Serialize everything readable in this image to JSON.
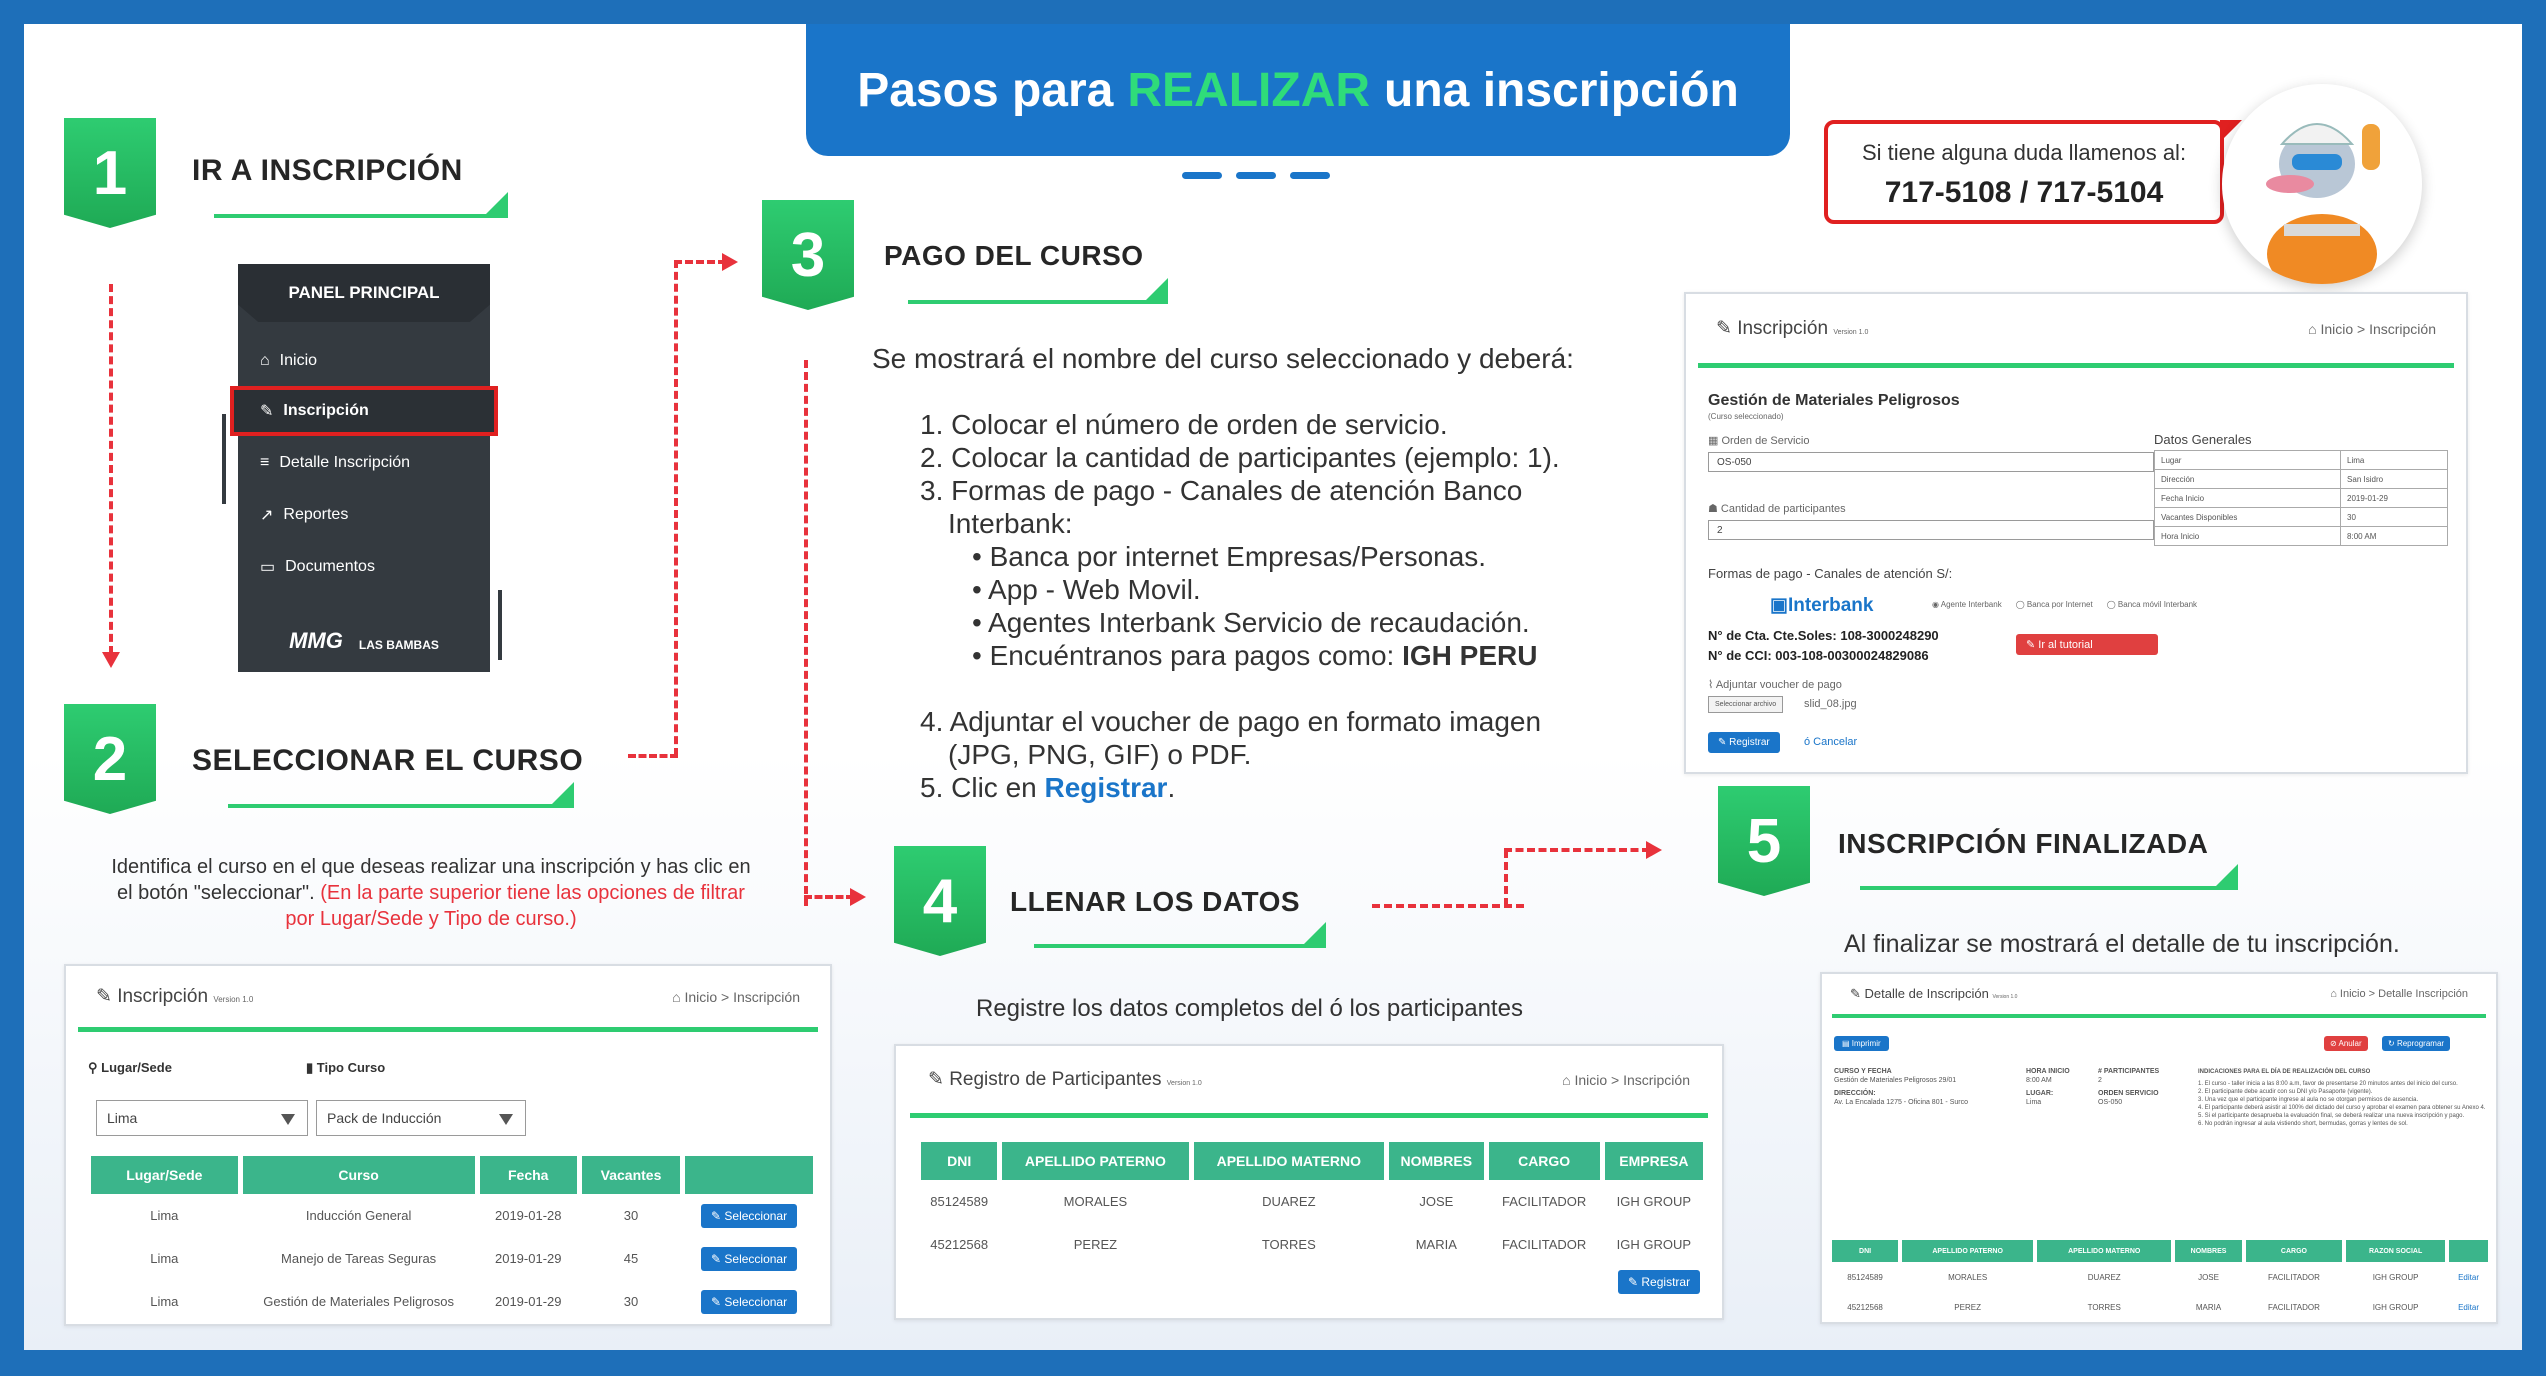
{
  "header": {
    "title_pre": "Pasos para",
    "title_hl": "REALIZAR",
    "title_post": "una inscripción"
  },
  "help": {
    "question": "Si tiene alguna duda llamenos al:",
    "phones": "717-5108 / 717-5104"
  },
  "steps": [
    {
      "num": "1",
      "title": "IR A INSCRIPCIÓN"
    },
    {
      "num": "2",
      "title": "SELECCIONAR EL CURSO"
    },
    {
      "num": "3",
      "title": "PAGO DEL CURSO"
    },
    {
      "num": "4",
      "title": "LLENAR LOS DATOS"
    },
    {
      "num": "5",
      "title": "INSCRIPCIÓN FINALIZADA"
    }
  ],
  "panel": {
    "header": "PANEL PRINCIPAL",
    "items": [
      "Inicio",
      "Inscripción",
      "Detalle Inscripción",
      "Reportes",
      "Documentos"
    ],
    "logo1": "MMG",
    "logo2": "LAS BAMBAS"
  },
  "step2": {
    "text": "Identifica el curso en el que deseas realizar una inscripción  y has clic en el botón \"seleccionar\".",
    "note": "(En la parte superior tiene las opciones de filtrar por Lugar/Sede y Tipo de curso.)"
  },
  "shot2": {
    "title": "Inscripción",
    "version": "Version 1.0",
    "breadcrumb": "Inicio > Inscripción",
    "filter1_label": "Lugar/Sede",
    "filter2_label": "Tipo Curso",
    "filter1_value": "Lima",
    "filter2_value": "Pack de Inducción",
    "columns": [
      "Lugar/Sede",
      "Curso",
      "Fecha",
      "Vacantes",
      ""
    ],
    "rows": [
      {
        "lugar": "Lima",
        "curso": "Inducción General",
        "fecha": "2019-01-28",
        "vacantes": "30",
        "btn": "Seleccionar"
      },
      {
        "lugar": "Lima",
        "curso": "Manejo de Tareas Seguras",
        "fecha": "2019-01-29",
        "vacantes": "45",
        "btn": "Seleccionar"
      },
      {
        "lugar": "Lima",
        "curso": "Gestión de Materiales Peligrosos",
        "fecha": "2019-01-29",
        "vacantes": "30",
        "btn": "Seleccionar"
      }
    ]
  },
  "step3": {
    "intro": "Se mostrará el nombre del curso seleccionado y deberá:",
    "l1": "1. Colocar el número de orden de servicio.",
    "l2": "2. Colocar la cantidad de participantes (ejemplo: 1).",
    "l3a": "3. Formas de pago - Canales de atención Banco",
    "l3b": "Interbank:",
    "b1": "Banca por internet Empresas/Personas.",
    "b2": "App - Web Movil.",
    "b3": "Agentes Interbank Servicio de recaudación.",
    "b4pre": "Encuéntranos para pagos como: ",
    "b4strong": "IGH PERU",
    "l4a": "4. Adjuntar el voucher de pago en formato imagen",
    "l4b": "(JPG, PNG, GIF) o PDF.",
    "l5pre": "5. Clic en ",
    "l5link": "Registrar",
    "l5post": "."
  },
  "shot3": {
    "title": "Inscripción",
    "version": "Version 1.0",
    "breadcrumb": "Inicio > Inscripción",
    "course": "Gestión de Materiales Peligrosos",
    "course_sub": "(Curso seleccionado)",
    "orden_label": "Orden de Servicio",
    "orden_value": "OS-050",
    "cant_label": "Cantidad de participantes",
    "cant_value": "2",
    "datos_label": "Datos Generales",
    "datos": [
      {
        "k": "Lugar",
        "v": "Lima"
      },
      {
        "k": "Dirección",
        "v": "San Isidro"
      },
      {
        "k": "Fecha Inicio",
        "v": "2019-01-29"
      },
      {
        "k": "Vacantes Disponibles",
        "v": "30"
      },
      {
        "k": "Hora Inicio",
        "v": "8:00 AM"
      }
    ],
    "pago_label": "Formas de pago - Canales de atención S/:",
    "bank": "Interbank",
    "radios": [
      "Agente Interbank",
      "Banca por Internet",
      "Banca móvil Interbank"
    ],
    "cta": "N° de Cta. Cte.Soles: 108-3000248290",
    "cci": "N° de CCI: 003-108-00300024829086",
    "tutorial": "Ir al tutorial",
    "voucher_label": "Adjuntar voucher de pago",
    "file_btn": "Seleccionar archivo",
    "file_name": "slid_08.jpg",
    "register": "Registrar",
    "cancel": "ó Cancelar"
  },
  "step4": {
    "text": "Registre los datos completos del ó los participantes"
  },
  "shot4": {
    "title": "Registro de Participantes",
    "version": "Version 1.0",
    "breadcrumb": "Inicio > Inscripción",
    "columns": [
      "DNI",
      "APELLIDO PATERNO",
      "APELLIDO MATERNO",
      "NOMBRES",
      "CARGO",
      "EMPRESA"
    ],
    "rows": [
      [
        "85124589",
        "MORALES",
        "DUAREZ",
        "JOSE",
        "FACILITADOR",
        "IGH GROUP"
      ],
      [
        "45212568",
        "PEREZ",
        "TORRES",
        "MARIA",
        "FACILITADOR",
        "IGH GROUP"
      ]
    ],
    "register": "Registrar"
  },
  "step5": {
    "text": "Al finalizar se mostrará el detalle de tu inscripción."
  },
  "shot5": {
    "title": "Detalle de Inscripción",
    "version": "Version 1.0",
    "breadcrumb": "Inicio > Detalle Inscripción",
    "print": "Imprimir",
    "cancel": "Anular",
    "reprog": "Reprogramar",
    "curso_label": "CURSO Y FECHA",
    "curso_value": "Gestión de Materiales Peligrosos 29/01",
    "dir_label": "DIRECCIÓN:",
    "dir_value": "Av. La Encalada 1275 - Oficina 801 - Surco",
    "hora_label": "HORA INICIO",
    "hora_value": "8:00 AM",
    "lugar_label": "LUGAR:",
    "lugar_value": "Lima",
    "part_label": "# PARTICIPANTES",
    "part_value": "2",
    "orden_label": "ORDEN SERVICIO",
    "orden_value": "OS-050",
    "ind_title": "INDICACIONES PARA EL DÍA DE REALIZACIÓN DEL CURSO",
    "ind": [
      "1. El curso - taller inicia a las 8:00 a.m, favor de presentarse 20 minutos antes del inicio del curso.",
      "2. El participante debe acudir con su DNI y/o Pasaporte (vigente).",
      "3. Una vez que el participante ingrese al aula no se otorgan permisos de ausencia.",
      "4. El participante deberá asistir al 100% del dictado del curso y aprobar el examen para obtener su Anexo 4.",
      "5. Si el participante desaprueba la evaluación final, se deberá realizar una nueva inscripción y pago.",
      "6. No podrán ingresar al aula vistiendo short, bermudas, gorras y lentes de sol."
    ],
    "columns": [
      "DNI",
      "APELLIDO PATERNO",
      "APELLIDO MATERNO",
      "NOMBRES",
      "CARGO",
      "RAZON SOCIAL",
      ""
    ],
    "rows": [
      [
        "85124589",
        "MORALES",
        "DUAREZ",
        "JOSE",
        "FACILITADOR",
        "IGH GROUP",
        "Editar"
      ],
      [
        "45212568",
        "PEREZ",
        "TORRES",
        "MARIA",
        "FACILITADOR",
        "IGH GROUP",
        "Editar"
      ]
    ]
  }
}
